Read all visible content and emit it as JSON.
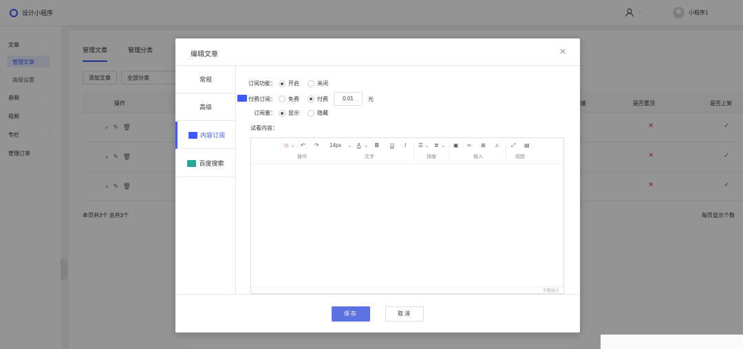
{
  "app": {
    "title": "设计小程序",
    "user_name": "小程序1"
  },
  "sidebar": {
    "groups": [
      {
        "label": "文章"
      },
      {
        "label": "音频"
      },
      {
        "label": "视频"
      },
      {
        "label": "专栏"
      },
      {
        "label": "管理订单"
      }
    ],
    "sub_items": [
      {
        "label": "管理文章"
      },
      {
        "label": "高级设置"
      }
    ]
  },
  "content": {
    "tabs": [
      "管理文章",
      "管理分类"
    ],
    "add_button": "添加文章",
    "filter": "全部分类",
    "columns": {
      "ops": "操作",
      "read": "阅量",
      "top": "是否置顶",
      "published": "是否上架"
    },
    "rows": 3,
    "summary": "本页共3个  总共3个",
    "per_page": "每页显示个数"
  },
  "modal": {
    "title": "编辑文章",
    "nav": [
      {
        "label": "常规"
      },
      {
        "label": "高级"
      },
      {
        "label": "内容订阅",
        "icon_color": "#3d5afe"
      },
      {
        "label": "百度搜索",
        "icon_color": "#26a69a"
      }
    ],
    "form": {
      "subscribe_label": "订阅功能：",
      "subscribe_on": "开启",
      "subscribe_off": "关闭",
      "pay_label": "付费订阅：",
      "pay_free": "免费",
      "pay_paid": "付费",
      "price": "0.01",
      "currency": "元",
      "count_label": "订阅量：",
      "count_show": "显示",
      "count_hide": "隐藏",
      "preview_label": "试看内容："
    },
    "toolbar": {
      "font_size": "14px",
      "groups": [
        "操作",
        "文字",
        "排版",
        "插入",
        "视图"
      ],
      "bold": "B",
      "underline": "U",
      "italic": "I",
      "color": "A",
      "music": "♫"
    },
    "editor_footer": "字数统计",
    "save": "保存",
    "cancel": "取消"
  }
}
